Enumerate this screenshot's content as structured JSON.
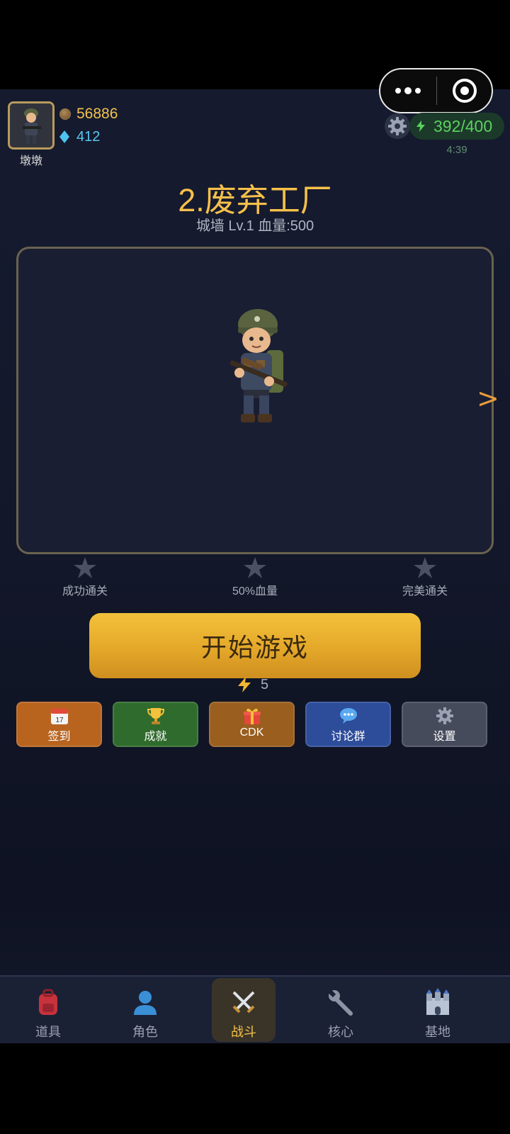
{
  "player": {
    "name": "墩墩",
    "coins": "56886",
    "gems": "412",
    "energy": "392/400",
    "energy_timer": "4:39"
  },
  "level": {
    "title": "2.废弃工厂",
    "subtitle": "城墙 Lv.1  血量:500",
    "next_arrow": ">"
  },
  "stars": [
    {
      "label": "成功通关",
      "icon": "star-icon"
    },
    {
      "label": "50%血量",
      "icon": "star-icon"
    },
    {
      "label": "完美通关",
      "icon": "star-icon"
    }
  ],
  "start": {
    "label": "开始游戏",
    "cost": "5"
  },
  "actions": [
    {
      "label": "签到",
      "icon": "calendar-icon",
      "color": "#b8641f"
    },
    {
      "label": "成就",
      "icon": "trophy-icon",
      "color": "#2f6b2c"
    },
    {
      "label": "CDK",
      "icon": "gift-icon",
      "color": "#9a5e1e"
    },
    {
      "label": "讨论群",
      "icon": "chat-icon",
      "color": "#2d4c9a"
    },
    {
      "label": "设置",
      "icon": "gear-icon",
      "color": "#464b5c"
    }
  ],
  "tabs": [
    {
      "label": "道具",
      "icon": "backpack-icon"
    },
    {
      "label": "角色",
      "icon": "person-icon"
    },
    {
      "label": "战斗",
      "icon": "crossed-swords-icon",
      "active": true
    },
    {
      "label": "核心",
      "icon": "wrench-icon"
    },
    {
      "label": "基地",
      "icon": "castle-icon"
    }
  ],
  "colors": {
    "gold": "#f6c04a",
    "energy_green": "#5bd15f",
    "gem_blue": "#59c7f0",
    "background": "#141a2d"
  }
}
